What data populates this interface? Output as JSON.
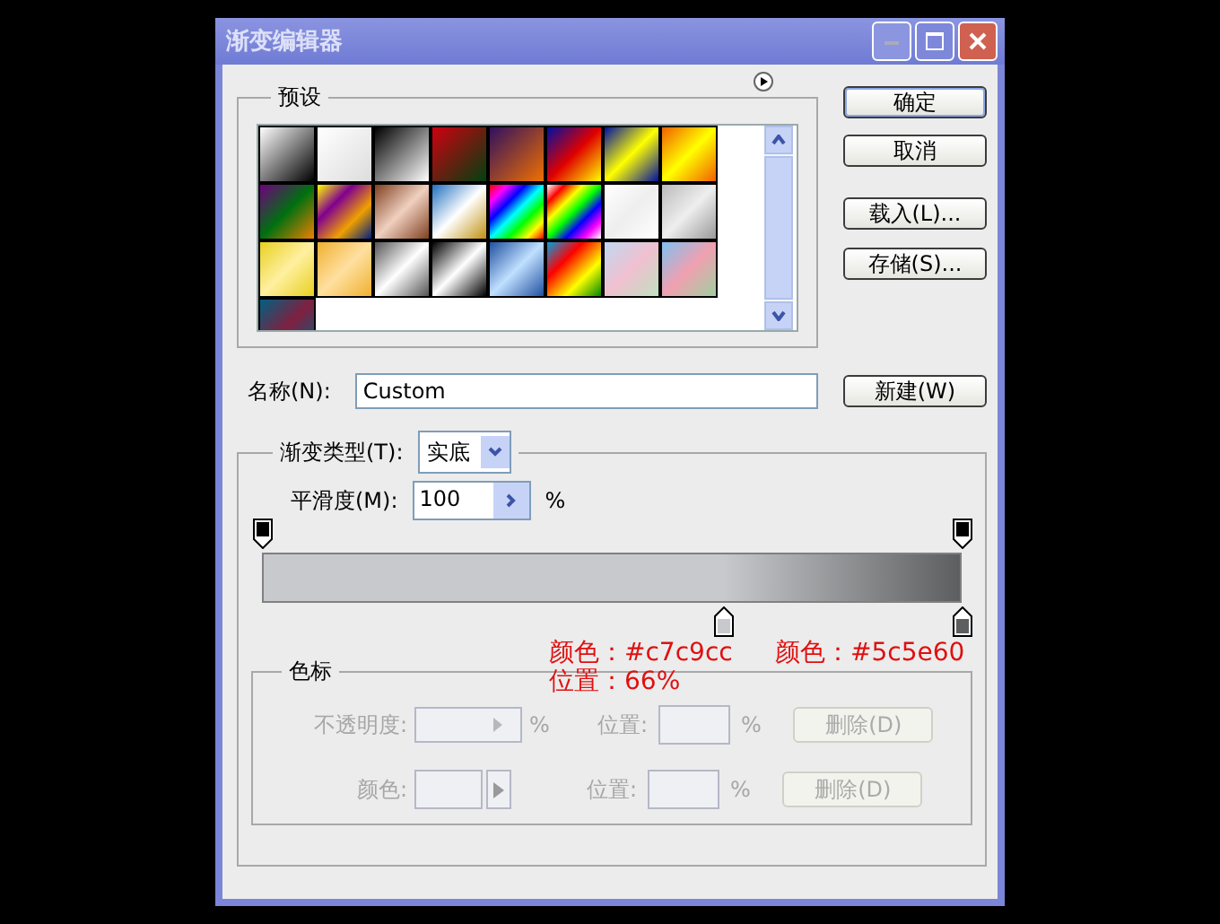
{
  "window": {
    "title": "渐变编辑器"
  },
  "presets": {
    "label": "预设"
  },
  "buttons": [
    {
      "label": "确定",
      "default": true
    },
    {
      "label": "取消",
      "default": false
    },
    {
      "label": "载入(L)...",
      "default": false
    },
    {
      "label": "存储(S)...",
      "default": false
    }
  ],
  "name_field": {
    "label": "名称(N):",
    "value": "Custom",
    "button": "新建(W)"
  },
  "gradient": {
    "type_label": "渐变类型(T):",
    "type_value": "实底",
    "smoothness_label": "平滑度(M):",
    "smoothness_value": "100",
    "smoothness_unit": "%",
    "opacity_stops": [
      {
        "level": 0
      },
      {
        "level": 1
      }
    ],
    "color_stops": [
      {
        "level": 0.66,
        "color": "#c7c9cc"
      },
      {
        "level": 1,
        "color": "#5c5e60"
      }
    ]
  },
  "annotations": [
    {
      "text": "颜色：#c7c9cc"
    },
    {
      "text": "位置：66%"
    },
    {
      "text": "颜色：#5c5e60"
    }
  ],
  "stops_group": {
    "title": "色标",
    "rows": [
      {
        "label": "不透明度:",
        "unit": "%",
        "position_label": "位置:",
        "position_unit": "%",
        "delete": "删除(D)",
        "kind": "opacity",
        "disabled": true
      },
      {
        "label": "颜色:",
        "unit": "",
        "position_label": "位置:",
        "position_unit": "%",
        "delete": "删除(D)",
        "kind": "color",
        "disabled": true
      }
    ]
  }
}
